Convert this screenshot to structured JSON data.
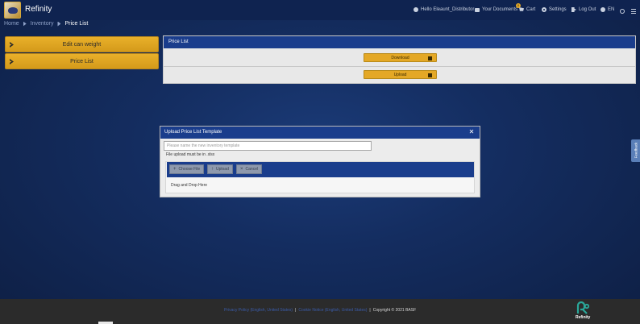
{
  "header": {
    "app_title": "Refinity",
    "greeting": "Hello Eleaunt_Distributor",
    "documents": "Your Documents",
    "cart": "Cart",
    "cart_count": "0",
    "settings": "Settings",
    "logout": "Log Out",
    "language": "EN"
  },
  "breadcrumb": {
    "home": "Home",
    "inventory": "Inventory",
    "current": "Price List"
  },
  "sidebar": {
    "items": [
      {
        "label": "Edit can weight"
      },
      {
        "label": "Price List"
      }
    ]
  },
  "panel": {
    "title": "Price List",
    "download_label": "Download",
    "upload_label": "Upload"
  },
  "feedback": {
    "label": "Feedback"
  },
  "modal": {
    "title": "Upload Price List Template",
    "close_glyph": "✕",
    "input_placeholder": "Please name the new inventory template",
    "note": "File upload must be in .xlsx",
    "choose_file": "Choose File",
    "upload": "Upload",
    "cancel": "Cancel",
    "drag_drop": "Drag and Drop Here"
  },
  "footer": {
    "privacy": "Privacy Policy (English, United States)",
    "cookie": "Cookie Notice (English, United States)",
    "copyright": "Copyright © 2021 BASF",
    "brand": "Refinity"
  },
  "colors": {
    "header_bg": "#0f2350",
    "accent_blue": "#1a3d8c",
    "gold": "#e4a826",
    "footer_bg": "#2b2b2b"
  }
}
